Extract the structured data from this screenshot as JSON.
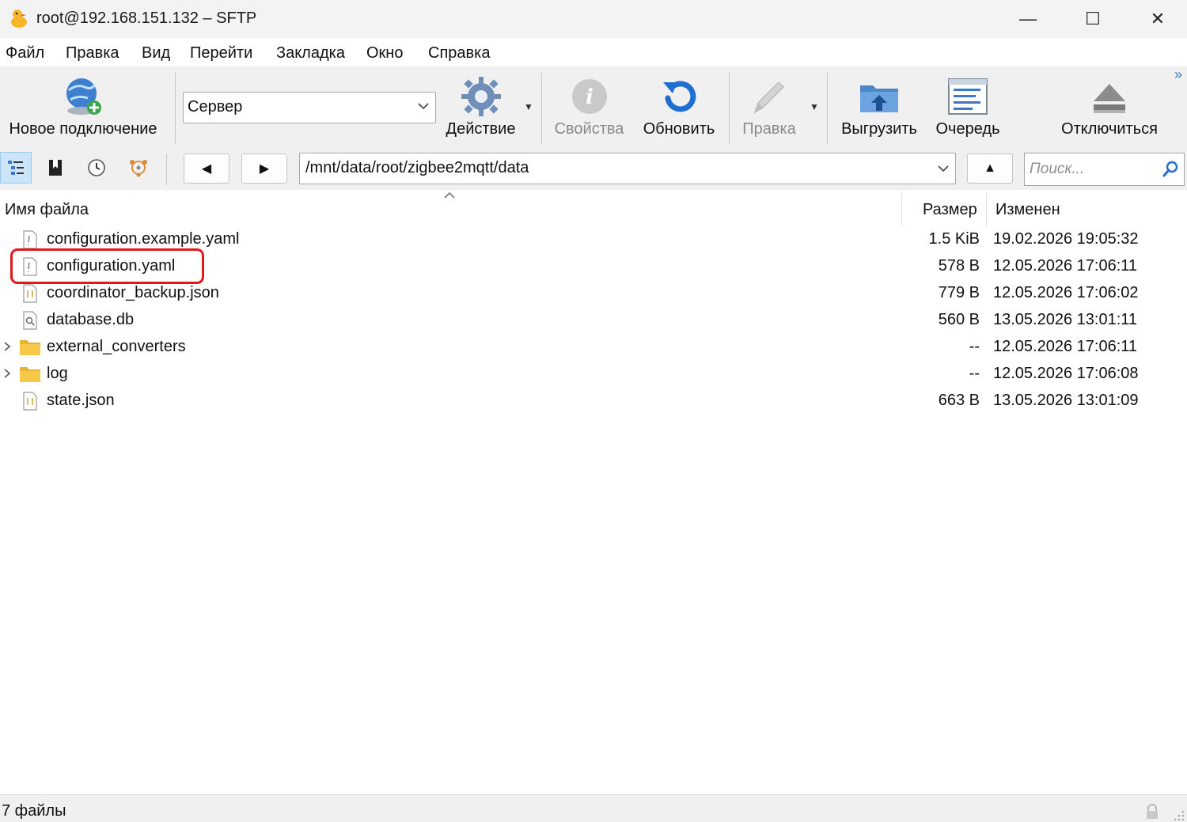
{
  "window": {
    "title": "root@192.168.151.132 – SFTP",
    "minimize_glyph": "—",
    "maximize_glyph": "☐",
    "close_glyph": "✕"
  },
  "menu": [
    "Файл",
    "Правка",
    "Вид",
    "Перейти",
    "Закладка",
    "Окно",
    "Справка"
  ],
  "toolbar": {
    "new_connection": "Новое подключение",
    "site_select_value": "Сервер",
    "action": "Действие",
    "properties": "Свойства",
    "refresh": "Обновить",
    "edit": "Правка",
    "upload": "Выгрузить",
    "queue": "Очередь",
    "disconnect": "Отключиться",
    "overflow": "»"
  },
  "nav": {
    "back": "◀",
    "forward": "▶",
    "path": "/mnt/data/root/zigbee2mqtt/data",
    "up": "▲",
    "search_placeholder": "Поиск..."
  },
  "columns": {
    "name": "Имя файла",
    "size": "Размер",
    "modified": "Изменен"
  },
  "files": [
    {
      "name": "configuration.example.yaml",
      "size": "1.5 KiB",
      "modified": "19.02.2026 19:05:32",
      "kind": "yaml",
      "folder": false
    },
    {
      "name": "configuration.yaml",
      "size": "578 B",
      "modified": "12.05.2026 17:06:11",
      "kind": "yaml",
      "folder": false
    },
    {
      "name": "coordinator_backup.json",
      "size": "779 B",
      "modified": "12.05.2026 17:06:02",
      "kind": "json",
      "folder": false
    },
    {
      "name": "database.db",
      "size": "560 B",
      "modified": "13.05.2026 13:01:11",
      "kind": "db",
      "folder": false
    },
    {
      "name": "external_converters",
      "size": "--",
      "modified": "12.05.2026 17:06:11",
      "kind": "folder",
      "folder": true
    },
    {
      "name": "log",
      "size": "--",
      "modified": "12.05.2026 17:06:08",
      "kind": "folder",
      "folder": true
    },
    {
      "name": "state.json",
      "size": "663 B",
      "modified": "13.05.2026 13:01:09",
      "kind": "json",
      "folder": false
    }
  ],
  "highlighted_file": "configuration.yaml",
  "status": {
    "text": "7 файлы"
  },
  "colors": {
    "highlight": "#e0191c",
    "toolbar_bg": "#f0f0f0",
    "folder": "#f7c948"
  }
}
